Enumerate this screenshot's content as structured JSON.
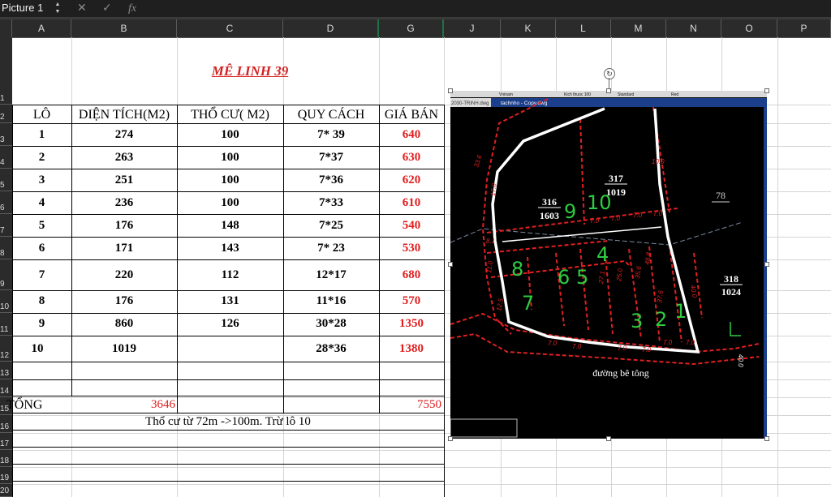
{
  "formula_bar": {
    "name_box": "Picture 1",
    "cancel_icon": "x-icon",
    "enter_icon": "check-icon",
    "fx_label": "fx"
  },
  "columns": [
    "A",
    "B",
    "C",
    "D",
    "G",
    "J",
    "K",
    "L",
    "M",
    "N",
    "O",
    "P"
  ],
  "rows": [
    "1",
    "2",
    "3",
    "4",
    "5",
    "6",
    "7",
    "8",
    "9",
    "10",
    "11",
    "12",
    "13",
    "14",
    "15",
    "16",
    "17",
    "18",
    "19",
    "20"
  ],
  "sheet": {
    "title": "MÊ LINH 39",
    "headers": [
      "LÔ",
      "DIỆN TÍCH(M2)",
      "THỔ CƯ( M2)",
      "QUY CÁCH",
      "GIÁ BÁN"
    ],
    "lots": [
      [
        "1",
        "274",
        "100",
        "7* 39",
        "640"
      ],
      [
        "2",
        "263",
        "100",
        "7*37",
        "630"
      ],
      [
        "3",
        "251",
        "100",
        "7*36",
        "620"
      ],
      [
        "4",
        "236",
        "100",
        "7*33",
        "610"
      ],
      [
        "5",
        "176",
        "148",
        "7*25",
        "540"
      ],
      [
        "6",
        "171",
        "143",
        "7* 23",
        "530"
      ],
      [
        "7",
        "220",
        "112",
        "12*17",
        "680"
      ],
      [
        "8",
        "176",
        "131",
        "11*16",
        "570"
      ],
      [
        "9",
        "860",
        "126",
        "30*28",
        "1350"
      ],
      [
        "10",
        "1019",
        "",
        "28*36",
        "1380"
      ]
    ],
    "total_label": "TỔNG",
    "total_area": "3646",
    "total_price": "7550",
    "note": "Thổ cư từ 72m ->100m. Trừ lô 10"
  },
  "picture": {
    "toolbar_font": "Vninam",
    "toolbar_size": "Kich thuoc 100",
    "toolbar_style": "Standard",
    "toolbar_color": "Red",
    "tab_left": "2030-TRINH.dwg",
    "tab_active": "tachnho - Copy.dwg",
    "parcels": [
      {
        "num": "316",
        "area": "1603"
      },
      {
        "num": "317",
        "area": "1019"
      },
      {
        "num": "318",
        "area": "1024"
      },
      {
        "num": "78",
        "area": ""
      }
    ],
    "road_label": "đường bê tông",
    "lot_numbers": [
      "9",
      "10",
      "8",
      "6",
      "5",
      "4",
      "7",
      "3",
      "2",
      "1"
    ],
    "dims": [
      "7.0",
      "7.0",
      "7.0",
      "7.0",
      "7.0",
      "7.0",
      "7.0",
      "7.0",
      "7.0",
      "7.0",
      "10.0",
      "33.6",
      "8.1",
      "11.0",
      "12.5",
      "40.0",
      "17.0",
      "25.0",
      "27.1",
      "35.6",
      "37.6",
      "48.8"
    ],
    "colors": {
      "background": "#000000",
      "boundary": "#ffffff",
      "lines": "#e02020",
      "handwriting": "#2ecc40",
      "text": "#ffffff"
    }
  }
}
